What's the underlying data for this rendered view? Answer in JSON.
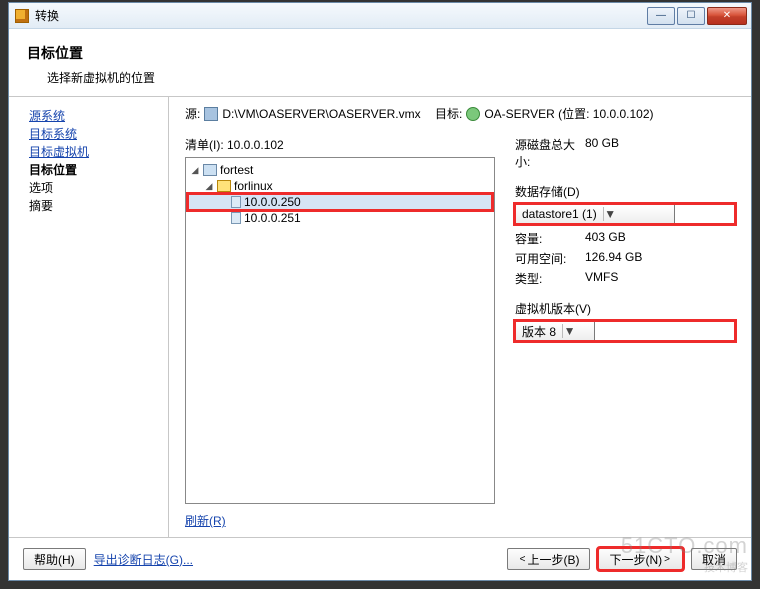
{
  "window": {
    "title": "转换"
  },
  "header": {
    "title": "目标位置",
    "subtitle": "选择新虚拟机的位置"
  },
  "sidebar": {
    "items": [
      {
        "label": "源系统",
        "state": "link"
      },
      {
        "label": "目标系统",
        "state": "link"
      },
      {
        "label": "目标虚拟机",
        "state": "link"
      },
      {
        "label": "目标位置",
        "state": "current"
      },
      {
        "label": "选项",
        "state": "plain"
      },
      {
        "label": "摘要",
        "state": "plain"
      }
    ]
  },
  "source": {
    "label": "源:",
    "value": "D:\\VM\\OASERVER\\OASERVER.vmx"
  },
  "target": {
    "label": "目标:",
    "value": "OA-SERVER (位置: 10.0.0.102)"
  },
  "inventory": {
    "label": "清单(I): 10.0.0.102",
    "tree": {
      "root": "fortest",
      "folder": "forlinux",
      "nodes": [
        "10.0.0.250",
        "10.0.0.251"
      ],
      "selected": "10.0.0.250"
    },
    "refresh": "刷新(R)"
  },
  "right": {
    "src_size_label": "源磁盘总大小:",
    "src_size_value": "80 GB",
    "datastore": {
      "label": "数据存储(D)",
      "selected": "datastore1 (1)"
    },
    "capacity_label": "容量:",
    "capacity_value": "403 GB",
    "free_label": "可用空间:",
    "free_value": "126.94 GB",
    "type_label": "类型:",
    "type_value": "VMFS",
    "vmver": {
      "label": "虚拟机版本(V)",
      "selected": "版本 8"
    }
  },
  "footer": {
    "help": "帮助(H)",
    "export": "导出诊断日志(G)...",
    "back": "上一步(B)",
    "next": "下一步(N)",
    "cancel": "取消"
  },
  "watermark": {
    "main": "51CTO.com",
    "sub": "技术博客"
  }
}
